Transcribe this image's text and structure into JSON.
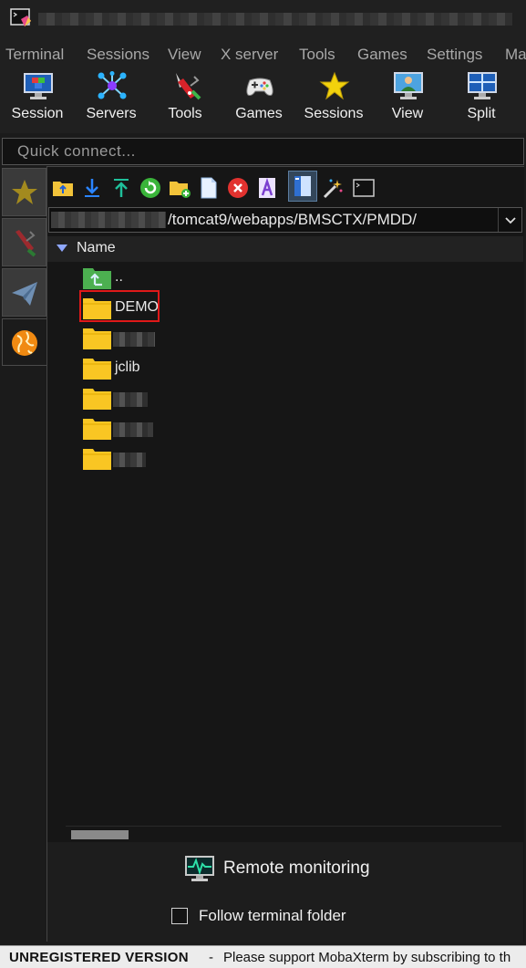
{
  "menu": [
    "Terminal",
    "Sessions",
    "View",
    "X server",
    "Tools",
    "Games",
    "Settings",
    "Ma"
  ],
  "toolbar": {
    "session": "Session",
    "servers": "Servers",
    "tools": "Tools",
    "games": "Games",
    "sessions": "Sessions",
    "view": "View",
    "split": "Split"
  },
  "quick_connect": {
    "placeholder": "Quick connect..."
  },
  "sftp": {
    "path": "/tomcat9/webapps/BMSCTX/PMDD/",
    "column_name": "Name",
    "parent": "..",
    "folders": [
      "DEMO",
      "jclib"
    ]
  },
  "bottom": {
    "remote_monitoring": "Remote monitoring",
    "follow_terminal": "Follow terminal folder"
  },
  "status": {
    "version": "UNREGISTERED VERSION",
    "separator": "-",
    "message": "Please support MobaXterm by subscribing to th"
  },
  "colors": {
    "background": "#1b1b1b",
    "folder": "#f9c623",
    "highlight": "#e01919",
    "accent": "#8fa8ff"
  }
}
